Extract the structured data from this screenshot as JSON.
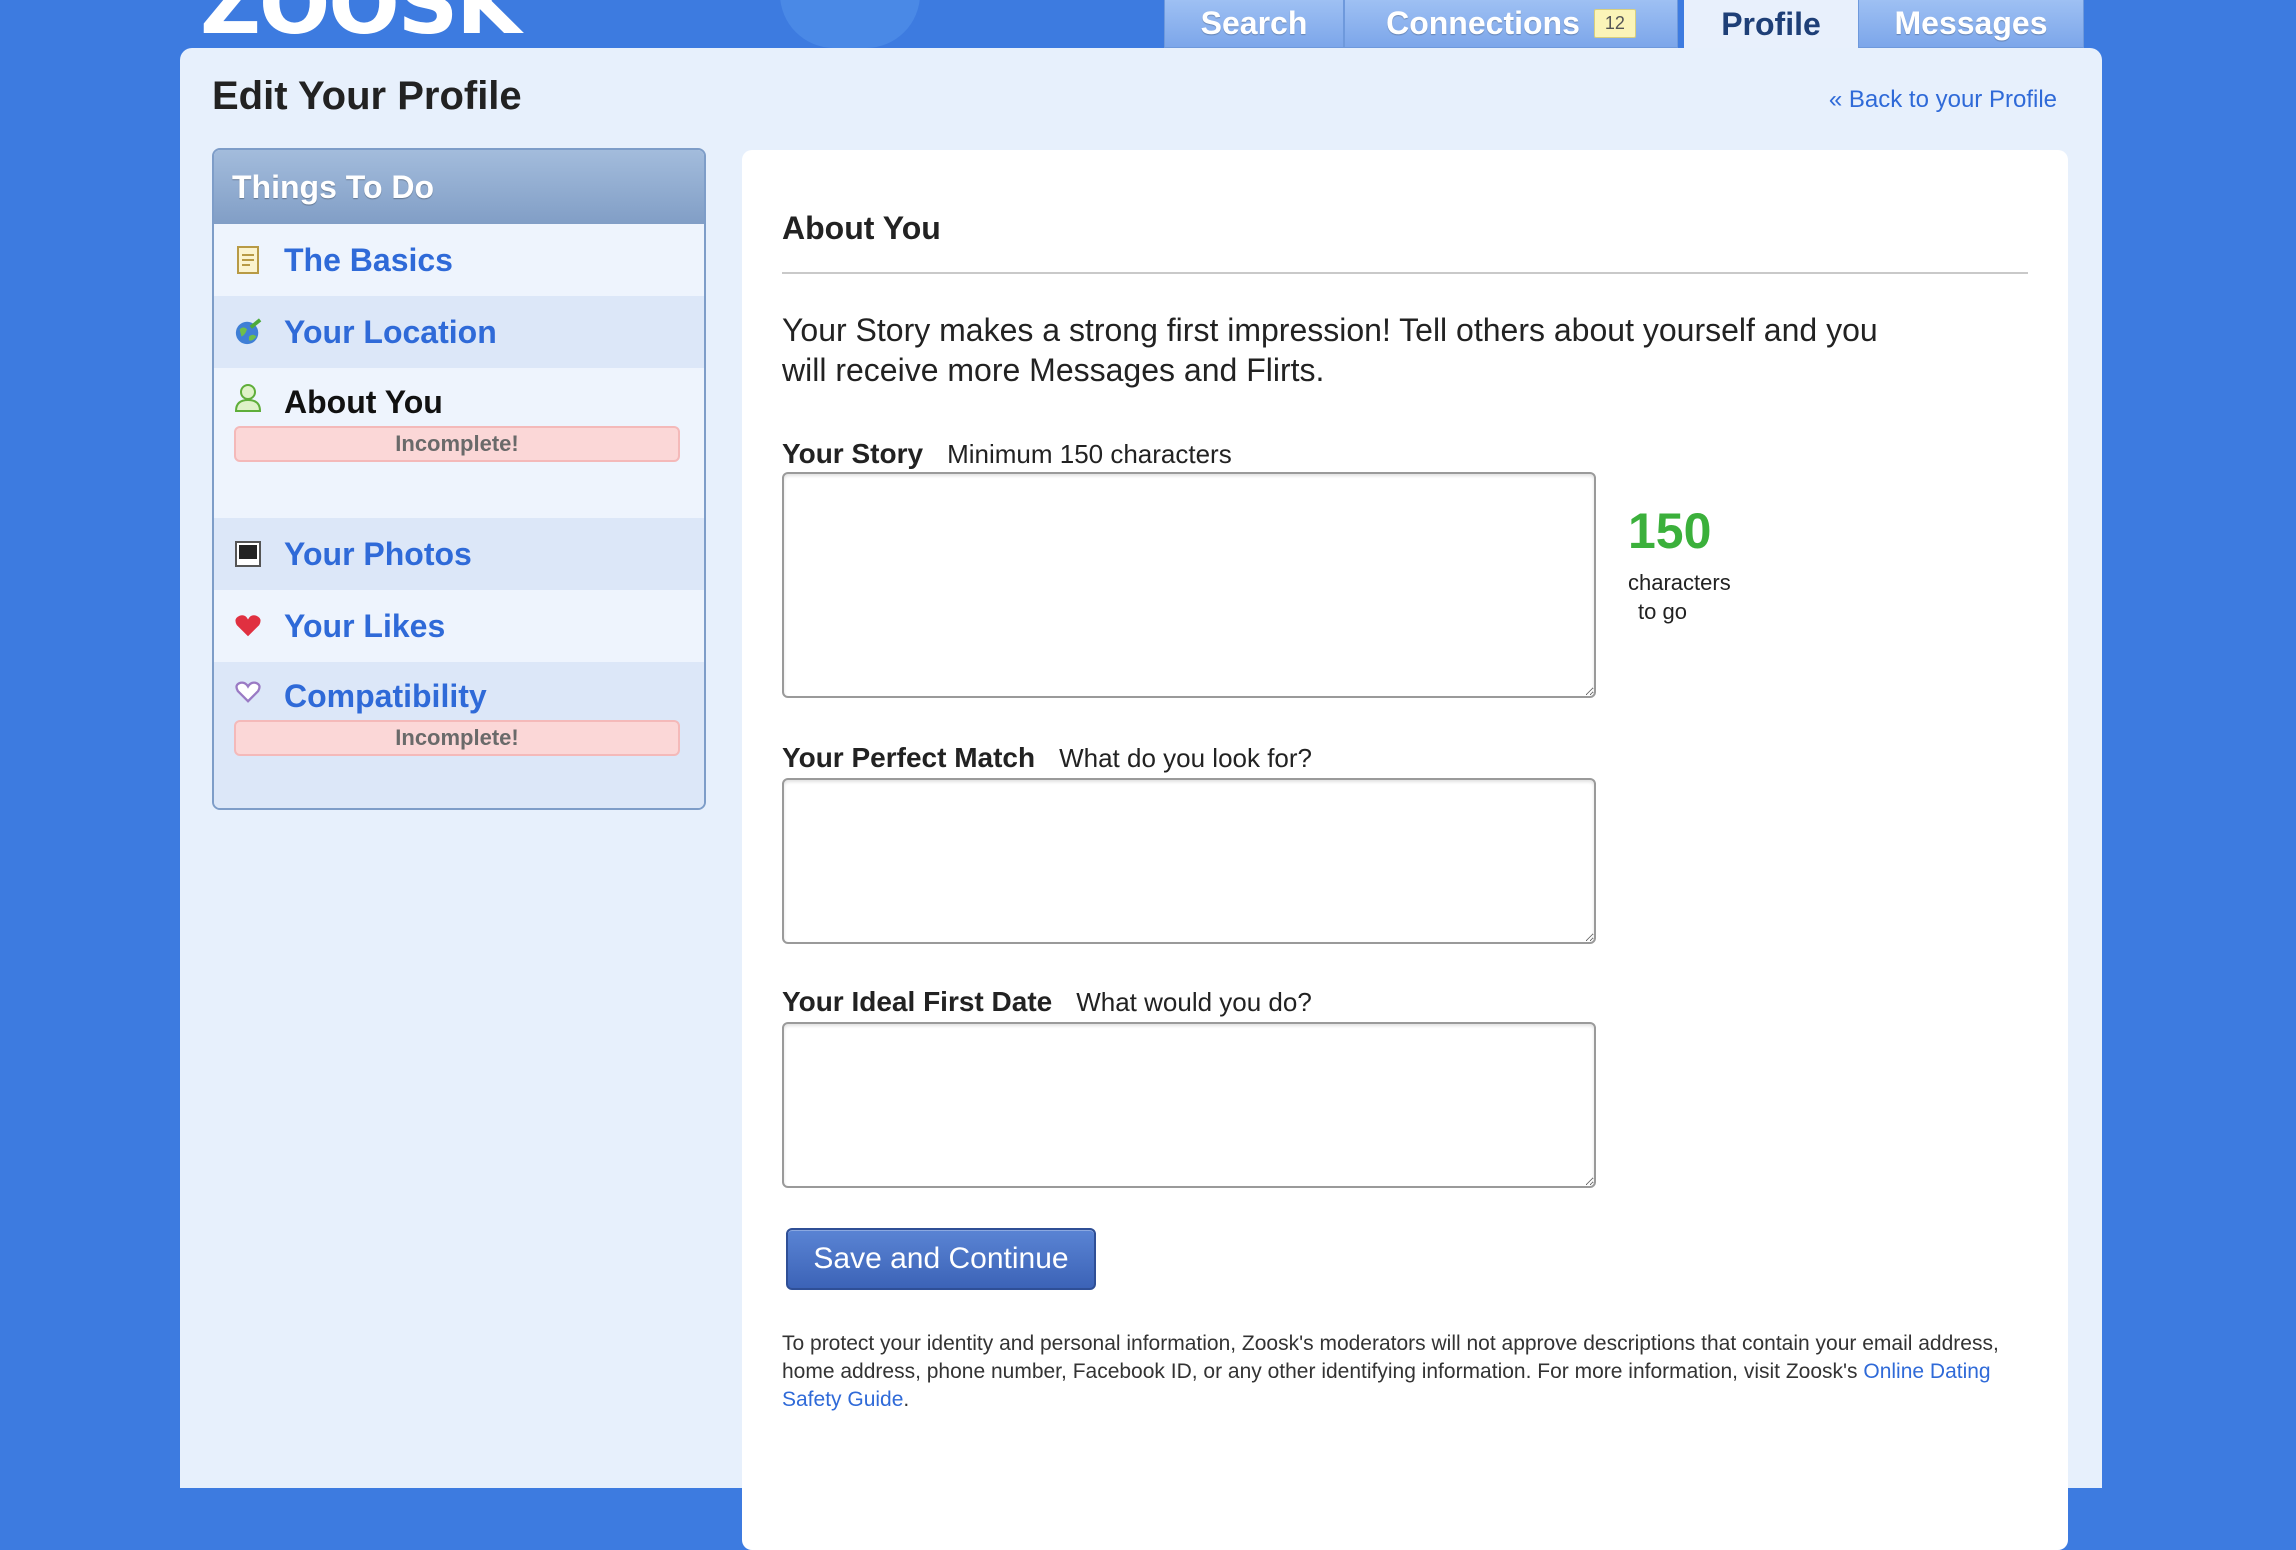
{
  "header": {
    "logo": "ZOOSK",
    "tabs": [
      {
        "label": "Search"
      },
      {
        "label": "Connections",
        "badge": "12"
      },
      {
        "label": "Profile",
        "active": true
      },
      {
        "label": "Messages"
      }
    ]
  },
  "page": {
    "title": "Edit Your Profile",
    "back_link": "« Back to your Profile"
  },
  "sidebar": {
    "heading": "Things To Do",
    "items": [
      {
        "label": "The Basics",
        "icon": "document-icon"
      },
      {
        "label": "Your Location",
        "icon": "globe-icon"
      },
      {
        "label": "About You",
        "icon": "person-icon",
        "status": "Incomplete!",
        "current": true
      },
      {
        "label": "Your Photos",
        "icon": "photo-icon"
      },
      {
        "label": "Your Likes",
        "icon": "heart-icon"
      },
      {
        "label": "Compatibility",
        "icon": "heart-outline-icon",
        "status": "Incomplete!"
      }
    ]
  },
  "main": {
    "section_title": "About You",
    "intro": "Your Story makes a strong first impression! Tell others about yourself and you will receive more Messages and Flirts.",
    "fields": [
      {
        "label": "Your Story",
        "hint": "Minimum 150 characters",
        "value": ""
      },
      {
        "label": "Your Perfect Match",
        "hint": "What do you look for?",
        "value": ""
      },
      {
        "label": "Your Ideal First Date",
        "hint": "What would you do?",
        "value": ""
      }
    ],
    "counter": {
      "value": "150",
      "line1": "characters",
      "line2": "to go"
    },
    "save_button": "Save and Continue",
    "fine_print": "To protect your identity and personal information, Zoosk's moderators will not approve descriptions that contain your email address, home address, phone number, Facebook ID, or any other identifying information. For more information, visit Zoosk's",
    "fine_print_link": "Online Dating Safety Guide",
    "fine_print_end": "."
  },
  "colors": {
    "background": "#3d7be0",
    "link": "#2f6ad8",
    "counter": "#3bb03b",
    "incomplete_bg": "#fbd7d7"
  }
}
